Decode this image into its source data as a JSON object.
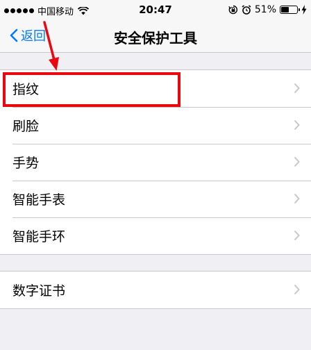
{
  "status_bar": {
    "carrier": "中国移动",
    "time": "20:47",
    "battery": "51%",
    "battery_level": 0.51,
    "icons": [
      "signal-dots-icon",
      "wifi-icon",
      "lock-rotation-icon",
      "alarm-icon",
      "battery-icon",
      "charging-bolt-icon"
    ]
  },
  "nav": {
    "back_label": "返回",
    "title": "安全保护工具"
  },
  "group1": {
    "items": [
      {
        "label": "指纹"
      },
      {
        "label": "刷脸"
      },
      {
        "label": "手势"
      },
      {
        "label": "智能手表"
      },
      {
        "label": "智能手环"
      }
    ]
  },
  "group2": {
    "items": [
      {
        "label": "数字证书"
      }
    ]
  },
  "colors": {
    "accent": "#007aff",
    "annotation": "#e8080e",
    "background": "#efeff4",
    "chevron": "#c7c7cc"
  }
}
